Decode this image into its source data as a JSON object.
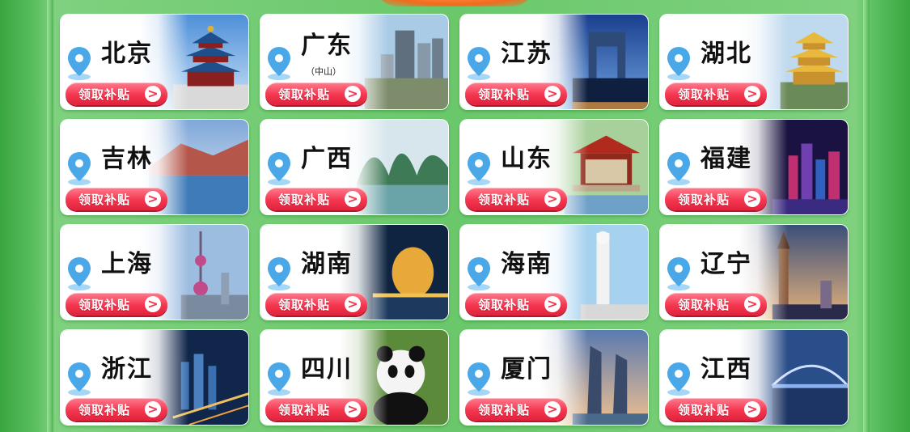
{
  "button_label": "领取补贴",
  "chevron_glyph": ">",
  "regions": [
    {
      "name": "北京",
      "sub": "",
      "scene": "temple-of-heaven"
    },
    {
      "name": "广东",
      "sub": "（中山）",
      "scene": "city-towers"
    },
    {
      "name": "江苏",
      "sub": "",
      "scene": "arch-skyline"
    },
    {
      "name": "湖北",
      "sub": "",
      "scene": "yellow-crane-tower"
    },
    {
      "name": "吉林",
      "sub": "",
      "scene": "mountain-lake"
    },
    {
      "name": "广西",
      "sub": "",
      "scene": "karst-river"
    },
    {
      "name": "山东",
      "sub": "",
      "scene": "pavilion"
    },
    {
      "name": "福建",
      "sub": "",
      "scene": "night-city"
    },
    {
      "name": "上海",
      "sub": "",
      "scene": "oriental-pearl"
    },
    {
      "name": "湖南",
      "sub": "",
      "scene": "golden-statue"
    },
    {
      "name": "海南",
      "sub": "",
      "scene": "guanyin-statue"
    },
    {
      "name": "辽宁",
      "sub": "",
      "scene": "clock-tower"
    },
    {
      "name": "浙江",
      "sub": "",
      "scene": "night-aerial"
    },
    {
      "name": "四川",
      "sub": "",
      "scene": "panda"
    },
    {
      "name": "厦门",
      "sub": "",
      "scene": "twin-towers"
    },
    {
      "name": "江西",
      "sub": "",
      "scene": "bridge-night"
    }
  ],
  "colors": {
    "bg_green": "#6ac86b",
    "button_red": "#f4364f",
    "pin_blue": "#4aa8e8"
  }
}
